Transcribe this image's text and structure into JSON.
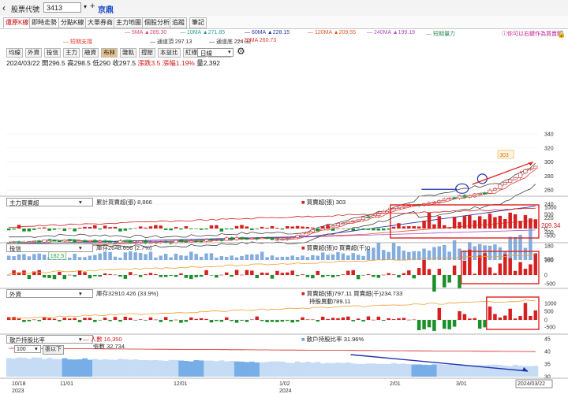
{
  "topbar": {
    "back_icon": "chevron-left-icon",
    "field_label": "股票代號",
    "code_value": "3413",
    "dropdown_icon": "caret-down-icon",
    "add_icon": "plus-icon",
    "stock_name": "京鼎"
  },
  "tabs": [
    "還原K線",
    "即時走勢",
    "分點K線",
    "大單券商",
    "主力地圖",
    "個股分析",
    "追蹤",
    "筆記"
  ],
  "ma_row1": [
    {
      "label": "5MA",
      "value": "▲289.30",
      "color": "#e0457a"
    },
    {
      "label": "10MA",
      "value": "▲271.85",
      "color": "#2aa198"
    },
    {
      "label": "60MA",
      "value": "▲228.15",
      "color": "#2b3aa8"
    },
    {
      "label": "120MA",
      "value": "▲209.55",
      "color": "#e4572e"
    },
    {
      "label": "240MA",
      "value": "▲199.19",
      "color": "#b04fc4"
    },
    {
      "label": "短期量力",
      "value": "",
      "color": "#2e8b57"
    }
  ],
  "ma_row2": [
    {
      "label": "短期支撐",
      "value": "",
      "color": "#e53935"
    },
    {
      "label": "通道頂",
      "value": "297.13",
      "color": "#333333"
    },
    {
      "label": "通道底",
      "value": "224.32",
      "color": "#333333"
    },
    {
      "label": "20MA",
      "value": "260.73",
      "color": "#e53935"
    },
    {
      "label": "長期量力",
      "value": "",
      "color": "#6a3d9a"
    }
  ],
  "hint": "你可以右鍵作為買賣點",
  "hint_icon": "info-icon",
  "lock_icon": "lock-icon",
  "toolbar": {
    "buttons": [
      "均線",
      "外資",
      "投信",
      "主力",
      "融資",
      "布林",
      "雜軌",
      "撐壓",
      "本益比",
      "紅綠燈",
      "分價量"
    ],
    "selected": "布林",
    "period": "日線",
    "settings_icon": "gear-icon"
  },
  "quote": {
    "date": "2024/03/22",
    "open_label": "開",
    "open": "296.5",
    "high_label": "高",
    "high": "298.5",
    "low_label": "低",
    "low": "290",
    "close_label": "收",
    "close": "297.5",
    "change_label": "漲跌",
    "change": "3.5",
    "pct_label": "漲幅",
    "pct": "1.19%",
    "vol_label": "量",
    "volume": "2,392"
  },
  "price_axis": [
    "340",
    "320",
    "300",
    "280",
    "260",
    "240",
    "220",
    "200",
    "180",
    "160"
  ],
  "current_price": "209.34",
  "peak_label": "303",
  "low_label": "182.5",
  "panels": [
    {
      "header": "主力買賣超",
      "legend1": "累計買賣超(張) 8,866",
      "legend2": "買賣超(張) 303",
      "axis": [
        "1000",
        "500",
        "0",
        "-500"
      ]
    },
    {
      "header": "投信",
      "legend1": "庫存2648.656 (2.7%)",
      "legend2": "買賣超(張)0 買賣超(千)0",
      "axis": [
        "500",
        "0",
        "-500"
      ]
    },
    {
      "header": "外資",
      "legend1": "庫存32910.426 (33.9%)",
      "legend2": "買賣超(張)797.11 買賣超(千)234.733",
      "legend3": "持股異動789.11",
      "axis": [
        "1000",
        "500",
        "0",
        "-500"
      ]
    },
    {
      "header": "散戶持股比率",
      "select_value": "100",
      "select_suffix": "張以下",
      "legend1": "人數 16,350",
      "legend1b": "張數 32,734",
      "legend2": "散戶持股比率 31.96%",
      "axis": [
        "45",
        "40",
        "35",
        "30"
      ]
    }
  ],
  "x_axis": [
    {
      "top": "10/18",
      "bottom": "2023"
    },
    {
      "top": "11/01",
      "bottom": ""
    },
    {
      "top": "12/01",
      "bottom": ""
    },
    {
      "top": "1/02",
      "bottom": "2024"
    },
    {
      "top": "2/01",
      "bottom": ""
    },
    {
      "top": "3/01",
      "bottom": ""
    },
    {
      "top": "2024/03/22",
      "bottom": ""
    }
  ],
  "colors": {
    "up": "#d42020",
    "down": "#1a8f2a",
    "volume": "#6f9fd8",
    "highlight_box": "#e02020",
    "trend_arrow": "#2230b0"
  }
}
